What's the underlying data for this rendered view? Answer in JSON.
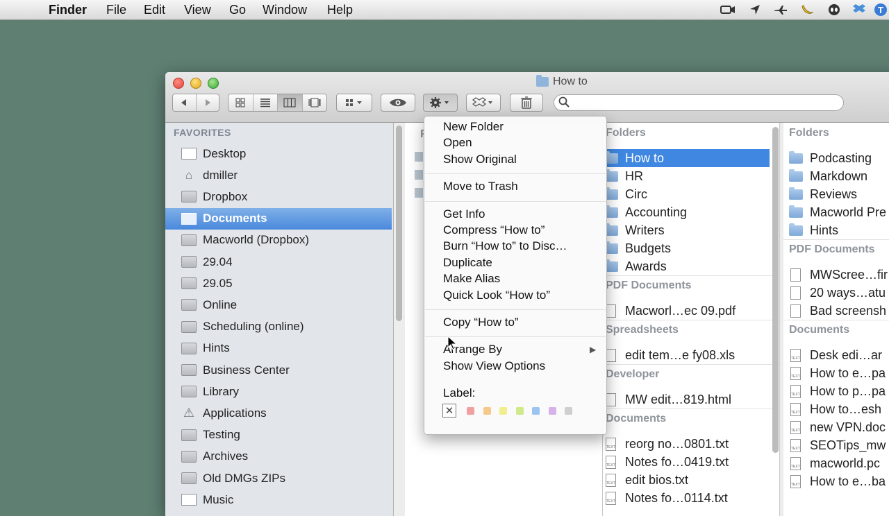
{
  "menubar": {
    "app": "Finder",
    "items": [
      "File",
      "Edit",
      "View",
      "Go",
      "Window",
      "Help"
    ],
    "status_icons": [
      "camera-icon",
      "location-icon",
      "plane-icon",
      "banana-icon",
      "alien-icon",
      "dropbox-icon",
      "user-t-icon"
    ]
  },
  "window": {
    "title": "How to"
  },
  "sidebar": {
    "heading": "FAVORITES",
    "items": [
      {
        "label": "Desktop",
        "icon": "desktop-icon"
      },
      {
        "label": "dmiller",
        "icon": "home-icon"
      },
      {
        "label": "Dropbox",
        "icon": "folder-icon"
      },
      {
        "label": "Documents",
        "icon": "documents-icon",
        "selected": true
      },
      {
        "label": "Macworld (Dropbox)",
        "icon": "folder-icon"
      },
      {
        "label": "29.04",
        "icon": "folder-icon"
      },
      {
        "label": "29.05",
        "icon": "folder-icon"
      },
      {
        "label": "Online",
        "icon": "folder-icon"
      },
      {
        "label": "Scheduling (online)",
        "icon": "folder-icon"
      },
      {
        "label": "Hints",
        "icon": "folder-icon"
      },
      {
        "label": "Business Center",
        "icon": "folder-icon"
      },
      {
        "label": "Library",
        "icon": "folder-icon"
      },
      {
        "label": "Applications",
        "icon": "applications-icon"
      },
      {
        "label": "Testing",
        "icon": "folder-icon"
      },
      {
        "label": "Archives",
        "icon": "folder-icon"
      },
      {
        "label": "Old DMGs ZIPs",
        "icon": "folder-icon"
      },
      {
        "label": "Music",
        "icon": "music-icon"
      }
    ]
  },
  "column1": {
    "heading_partial": "F"
  },
  "column2": {
    "sections": [
      {
        "heading": "Folders",
        "items": [
          {
            "label": "How to",
            "selected": true
          },
          {
            "label": "HR"
          },
          {
            "label": "Circ"
          },
          {
            "label": "Accounting"
          },
          {
            "label": "Writers"
          },
          {
            "label": "Budgets"
          },
          {
            "label": "Awards"
          }
        ]
      },
      {
        "heading": "PDF Documents",
        "items": [
          {
            "label": "Macworl…ec 09.pdf"
          }
        ]
      },
      {
        "heading": "Spreadsheets",
        "items": [
          {
            "label": "edit tem…e fy08.xls"
          }
        ]
      },
      {
        "heading": "Developer",
        "items": [
          {
            "label": "MW edit…819.html"
          }
        ]
      },
      {
        "heading": "Documents",
        "items": [
          {
            "label": "reorg no…0801.txt"
          },
          {
            "label": "Notes fo…0419.txt"
          },
          {
            "label": "edit bios.txt"
          },
          {
            "label": "Notes fo…0114.txt"
          }
        ]
      }
    ]
  },
  "column3": {
    "sections": [
      {
        "heading": "Folders",
        "items": [
          {
            "label": "Podcasting"
          },
          {
            "label": "Markdown"
          },
          {
            "label": "Reviews"
          },
          {
            "label": "Macworld Pre"
          },
          {
            "label": "Hints"
          }
        ]
      },
      {
        "heading": "PDF Documents",
        "items": [
          {
            "label": "MWScree…fir"
          },
          {
            "label": "20 ways…atu"
          },
          {
            "label": "Bad screensh"
          }
        ]
      },
      {
        "heading": "Documents",
        "items": [
          {
            "label": "Desk edi…ar"
          },
          {
            "label": "How to e…pa"
          },
          {
            "label": "How to p…pa"
          },
          {
            "label": "How to…esh"
          },
          {
            "label": "new VPN.doc"
          },
          {
            "label": "SEOTips_mw"
          },
          {
            "label": "macworld.pc"
          },
          {
            "label": "How to e…ba"
          }
        ]
      }
    ]
  },
  "context_menu": {
    "groups": [
      [
        "New Folder",
        "Open",
        "Show Original"
      ],
      [
        "Move to Trash"
      ],
      [
        "Get Info",
        "Compress “How to”",
        "Burn “How to” to Disc…",
        "Duplicate",
        "Make Alias",
        "Quick Look “How to”"
      ],
      [
        "Copy “How to”"
      ],
      [
        "Arrange By",
        "Show View Options"
      ]
    ],
    "label_heading": "Label:",
    "label_colors": [
      "#f0a0a0",
      "#f4c98a",
      "#f1ee8e",
      "#cfe98b",
      "#9cc4f2",
      "#d7b1ea",
      "#cfcfcf"
    ]
  },
  "colors": {
    "desktop": "#5f7f73",
    "selection": "#3f87e0"
  }
}
